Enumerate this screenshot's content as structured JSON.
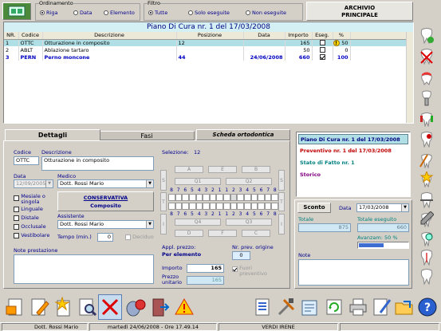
{
  "top": {
    "ordinamento_label": "Ordinamento",
    "ordinamento": [
      {
        "label": "Riga",
        "selected": true
      },
      {
        "label": "Data",
        "selected": false
      },
      {
        "label": "Elemento",
        "selected": false
      }
    ],
    "filtro_label": "Filtro",
    "filtro": [
      {
        "label": "Tutte",
        "selected": true
      },
      {
        "label": "Solo eseguite",
        "selected": false
      },
      {
        "label": "Non eseguite",
        "selected": false
      }
    ],
    "archivio_line1": "ARCHIVIO",
    "archivio_line2": "PRINCIPALE"
  },
  "plan": {
    "title": "Piano Di Cura nr. 1 del 17/03/2008",
    "columns": [
      "NR.",
      "Codice",
      "Descrizione",
      "Posizione",
      "Data",
      "Importo",
      "Eseg.",
      "%"
    ],
    "rows": [
      {
        "nr": "1",
        "codice": "OTTC",
        "descrizione": "Otturazione in composito",
        "posizione": "12",
        "data": "",
        "importo": "165",
        "eseguita": false,
        "perc": "50",
        "warn": true
      },
      {
        "nr": "2",
        "codice": "ABLT",
        "descrizione": "Ablazione tartaro",
        "posizione": "",
        "data": "",
        "importo": "50",
        "eseguita": false,
        "perc": "0",
        "warn": false
      },
      {
        "nr": "3",
        "codice": "PERN",
        "descrizione": "Perno moncone",
        "posizione": "44",
        "data": "24/06/2008",
        "importo": "660",
        "eseguita": true,
        "perc": "100",
        "warn": false
      }
    ]
  },
  "tabs": {
    "dettagli": "Dettagli",
    "fasi": "Fasi",
    "scheda": "Scheda ortodontica"
  },
  "detail": {
    "codice_label": "Codice",
    "codice": "OTTC",
    "descrizione_label": "Descrizione",
    "descrizione": "Otturazione in composito",
    "selezione_label": "Selezione:",
    "selezione": "12",
    "data_label": "Data",
    "data": "12/09/2005",
    "medico_label": "Medico",
    "medico": "Dott. Rossi Mario",
    "checks": [
      {
        "label": "Mesiale o singola",
        "checked": false
      },
      {
        "label": "Linguale",
        "checked": false
      },
      {
        "label": "Distale",
        "checked": false
      },
      {
        "label": "Occlusale",
        "checked": false
      },
      {
        "label": "Vestibolare",
        "checked": false
      }
    ],
    "categoria": "CONSERVATIVA",
    "sottocategoria": "Composito",
    "assistente_label": "Assistente",
    "assistente": "Dott. Rossi Mario",
    "tempo_label": "Tempo (min.)",
    "tempo": "0",
    "deciduo_label": "Deciduo",
    "note_prestazione_label": "Note prestazione",
    "appl_prezzo_label": "Appl. prezzo:",
    "appl_prezzo": "Per elemento",
    "nr_prev_label": "Nr. prev. origine",
    "nr_prev": "0",
    "importo_label": "Importo",
    "importo": "165",
    "prezzo_unitario_label": "Prezzo unitario",
    "prezzo_unitario": "165",
    "fuori_preventivo_label": "Fuori preventivo"
  },
  "odontogram": {
    "upper_top_buttons": [
      "A",
      "E",
      "B"
    ],
    "upper_quads": [
      "Q1",
      "Q2"
    ],
    "upper_numbers": [
      "8",
      "7",
      "6",
      "5",
      "4",
      "3",
      "2",
      "1",
      "1",
      "2",
      "3",
      "4",
      "5",
      "6",
      "7",
      "8"
    ],
    "lower_numbers": [
      "8",
      "7",
      "6",
      "5",
      "4",
      "3",
      "2",
      "1",
      "1",
      "2",
      "3",
      "4",
      "5",
      "6",
      "7",
      "8"
    ],
    "lower_quads": [
      "Q4",
      "Q3"
    ],
    "lower_bottom_buttons": [
      "D",
      "F",
      "C"
    ],
    "side_left": [
      "S",
      "T",
      "I"
    ],
    "side_right": [
      "S",
      "T",
      "I"
    ]
  },
  "docs": [
    {
      "label": "Piano Di Cura nr. 1 del 17/03/2008",
      "color": "#000080",
      "selected": true
    },
    {
      "label": "Preventivo nr. 1 del 17/03/2008",
      "color": "#c00000",
      "selected": false
    },
    {
      "label": "Stato di Fatto nr. 1",
      "color": "#008080",
      "selected": false
    },
    {
      "label": "Storico",
      "color": "#800080",
      "selected": false
    }
  ],
  "summary": {
    "sconto_label": "Sconto",
    "data_label": "Data",
    "data": "17/03/2008",
    "totale_label": "Totale",
    "totale": "875",
    "totale_eseguito_label": "Totale eseguito",
    "totale_eseguito": "660",
    "avanzam_label": "Avanzam: 50 %",
    "avanzam_value": 0.5,
    "note_label": "Note"
  },
  "status": {
    "doctor": "Dott. Rossi Mario",
    "datetime": "martedì 24/06/2008 - Ore 17.49.14",
    "patient": "VERDI IRENE"
  },
  "colors": {
    "accent": "#000080",
    "highlight_row": "#b0e0e6",
    "progress": "#3d6dd1"
  }
}
